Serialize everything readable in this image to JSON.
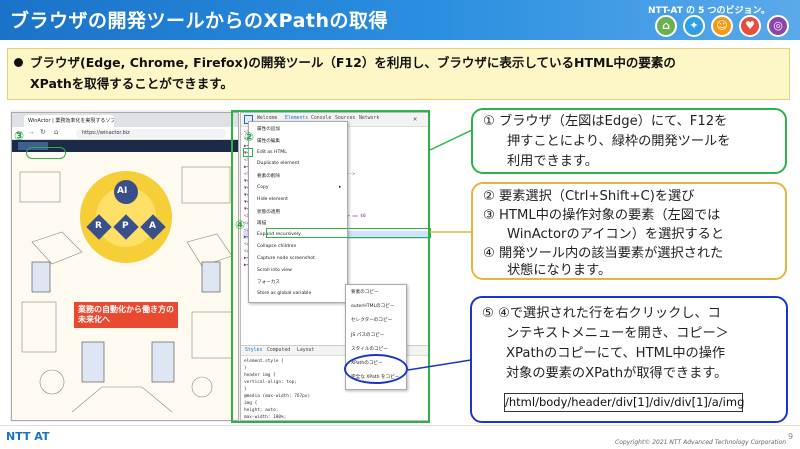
{
  "header": {
    "title": "ブラウザの開発ツールからのXPathの取得",
    "vision_label": "NTT-AT の 5 つのビジョン。",
    "vision_icons": [
      "vision-1-icon",
      "vision-2-icon",
      "vision-3-icon",
      "vision-4-icon",
      "vision-5-icon"
    ],
    "bar_color": "#1a73c9"
  },
  "summary": {
    "line1": "ブラウザ(Edge, Chrome, Firefox)の開発ツール（F12）を利用し、ブラウザに表示しているHTML中の要素の",
    "line2": "XPathを取得することができます。",
    "bg_color": "#fdf7c8"
  },
  "screenshot": {
    "browser_tab_title": "WinActor | 業務効率化を実現するソフトウェアロボット",
    "url": "https://winactor.biz",
    "devtools_tabs": [
      "Welcome",
      "Elements",
      "Console",
      "Sources",
      "Network"
    ],
    "code_lines": [
      "<!DOCTYPE html>",
      "<html lang=\"ja\">",
      "▶<head>...</head>",
      "▼<body class=\"home page-template\">",
      "  <!-- Google Tag Manager (noscript) -->",
      "  ▶<noscript>...</noscript>",
      "  <!-- End Google Tag Manager (noscript) -->",
      "  ▼<header class=\"header\">",
      "    ▼<div class=\"header__inner\">",
      "      ▼<div class=\"header__left\">",
      "        ▼<div class=\"header__logo\">",
      "          ▼<a href=\"/\">",
      "            <img src=\"/img/logo.svg\" alt=\"WinActor\"> == $0",
      "          </a>",
      "        </div>",
      "      ▶<div class=\"header__nav\">...</div>",
      "    </div>",
      "  </header>",
      "  ▶<div class=\"main\">...</div>",
      "  ▶<footer class=\"footer\">...</footer>"
    ],
    "context_menu": [
      "属性の追加",
      "属性の編集",
      "Edit as HTML",
      "Duplicate element",
      "要素の削除",
      "Copy",
      "Hide element",
      "状態の適用",
      "再描",
      "Expand recursively",
      "Collapse children",
      "Capture node screenshot",
      "Scroll into view",
      "フォーカス",
      "Store as global variable"
    ],
    "submenu": [
      "要素のコピー",
      "outerHTMLのコピー",
      "セレクターのコピー",
      "JS パスのコピー",
      "スタイルのコピー",
      "XPathのコピー",
      "完全な XPath をコピー"
    ],
    "styles_tabs": [
      "Styles",
      "Computed",
      "Layout"
    ],
    "styles_lines": [
      "element.style {",
      "}",
      "header img {",
      "  vertical-align: top;",
      "}",
      "@media (max-width: 767px)",
      "img {",
      "  height: auto;",
      "  max-width: 100%;",
      "}"
    ],
    "illustration_signs": [
      "AI",
      "R",
      "P",
      "A"
    ],
    "illustration_banner": "業務の自動化から働き方の未来化へ"
  },
  "markers": {
    "m2": "②",
    "m3": "③",
    "m4": "④"
  },
  "callouts": {
    "c1": {
      "lines": [
        "① ブラウザ（左図はEdge）にて、F12を",
        "押すことにより、緑枠の開発ツールを",
        "利用できます。"
      ],
      "color": "#2db24a"
    },
    "c2": {
      "lines": [
        "② 要素選択（Ctrl+Shift+C)を選び",
        "③ HTML中の操作対象の要素（左図では",
        "WinActorのアイコン）を選択すると",
        "④ 開発ツール内の該当要素が選択された",
        "状態になります。"
      ],
      "color": "#e9b33e"
    },
    "c3": {
      "lines": [
        "⑤ ④で選択された行を右クリックし、コ",
        "ンテキストメニューを開き、コピー＞",
        "XPathのコピーにて、HTML中の操作",
        "対象の要素のXPathが取得できます。"
      ],
      "xpath": "/html/body/header/div[1]/div/div[1]/a/img",
      "color": "#1a36c8"
    }
  },
  "footer": {
    "logo": "NTT AT",
    "copyright": "Copyright© 2021 NTT Advanced Technology Corporation",
    "page_number": "9"
  }
}
